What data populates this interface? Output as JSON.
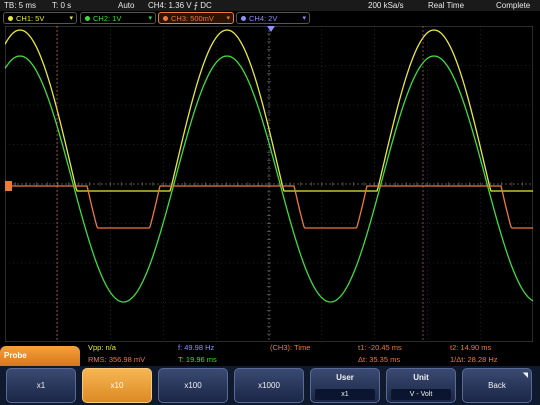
{
  "topbar": {
    "timebase": "TB: 5 ms",
    "offset": "T: 0 s",
    "mode": "Auto",
    "trigger": "CH4: 1.36 V ⨍ DC",
    "samplerate": "200 kSa/s",
    "acq": "Real Time",
    "status": "Complete"
  },
  "channels": [
    {
      "label": "CH1: 5V",
      "color": "#e8e845"
    },
    {
      "label": "CH2: 1V",
      "color": "#3fdc3f"
    },
    {
      "label": "CH3: 500mV",
      "color": "#ee7a3a"
    },
    {
      "label": "CH4: 2V",
      "color": "#8f8fff"
    }
  ],
  "measurements": {
    "vpp": "Vpp: n/a",
    "rms": "RMS: 356.98 mV",
    "freq": "f: 49.98 Hz",
    "period": "T: 19.96 ms",
    "source": "(CH3): Time",
    "t1": "t1: -20.45 ms",
    "dt": "Δt: 35.35 ms",
    "t2": "t2: 14.90 ms",
    "inv_dt": "1/Δt: 28.28 Hz"
  },
  "menu": {
    "title": "Probe",
    "keys": [
      {
        "label": "x1"
      },
      {
        "label": "x10"
      },
      {
        "label": "x100"
      },
      {
        "label": "x1000"
      },
      {
        "label": "User",
        "value": "x1"
      },
      {
        "label": "Unit",
        "value": "V - Volt"
      },
      {
        "label": "Back"
      }
    ]
  },
  "colors": {
    "ch1": "#e8e845",
    "ch2": "#3fdc3f",
    "ch3": "#ee7a3a",
    "ch4": "#8f8fff",
    "accent": "#e8942d",
    "grid": "#3a3a3a"
  }
}
